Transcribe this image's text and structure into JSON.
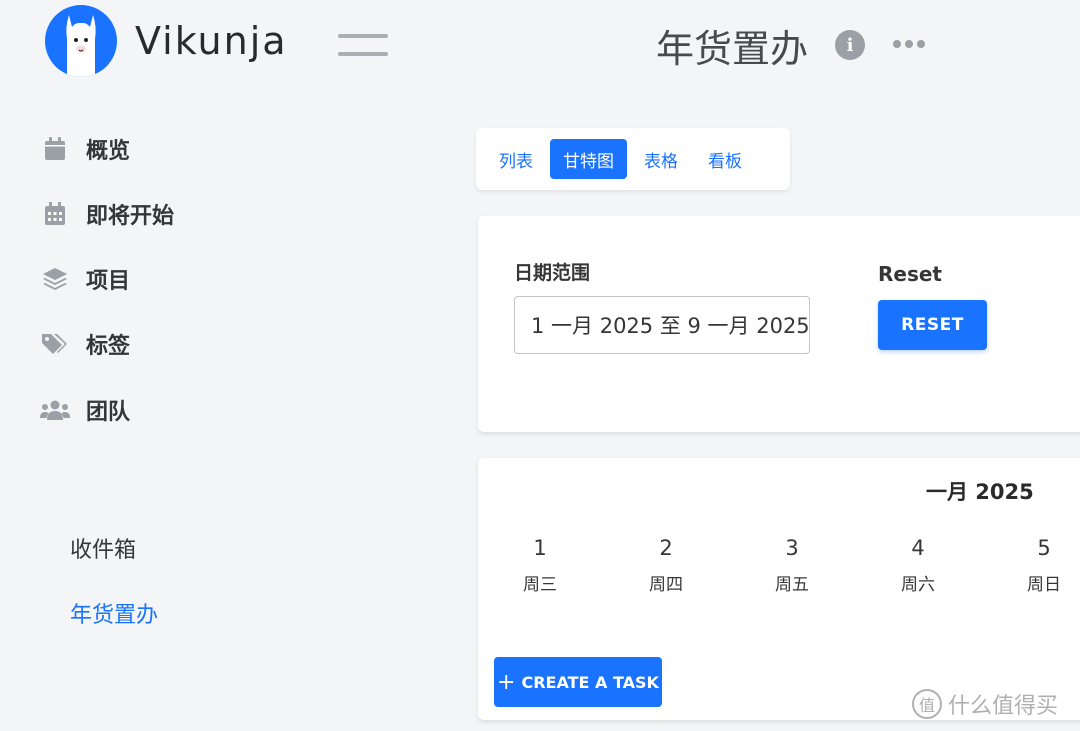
{
  "app": {
    "name": "Vikunja",
    "page_title": "年货置办"
  },
  "sidebar": {
    "nav": [
      {
        "label": "概览",
        "icon": "calendar-icon"
      },
      {
        "label": "即将开始",
        "icon": "calendar-grid-icon"
      },
      {
        "label": "项目",
        "icon": "layers-icon"
      },
      {
        "label": "标签",
        "icon": "tags-icon"
      },
      {
        "label": "团队",
        "icon": "users-icon"
      }
    ],
    "projects": [
      {
        "label": "收件箱",
        "active": false
      },
      {
        "label": "年货置办",
        "active": true
      }
    ]
  },
  "views": {
    "tabs": [
      {
        "label": "列表",
        "active": false
      },
      {
        "label": "甘特图",
        "active": true
      },
      {
        "label": "表格",
        "active": false
      },
      {
        "label": "看板",
        "active": false
      }
    ]
  },
  "filter": {
    "date_range_label": "日期范围",
    "date_range_value": "1 一月 2025 至 9 一月 2025",
    "reset_label": "Reset",
    "reset_button": "RESET"
  },
  "gantt": {
    "month": "一月 2025",
    "days": [
      {
        "num": "1",
        "name": "周三"
      },
      {
        "num": "2",
        "name": "周四"
      },
      {
        "num": "3",
        "name": "周五"
      },
      {
        "num": "4",
        "name": "周六"
      },
      {
        "num": "5",
        "name": "周日"
      }
    ],
    "create_task": "CREATE A TASK"
  },
  "watermark": {
    "icon_text": "值",
    "text": "什么值得买"
  },
  "colors": {
    "accent": "#1973ff",
    "background": "#f4f5f7",
    "icon_gray": "#9aa0a6"
  }
}
